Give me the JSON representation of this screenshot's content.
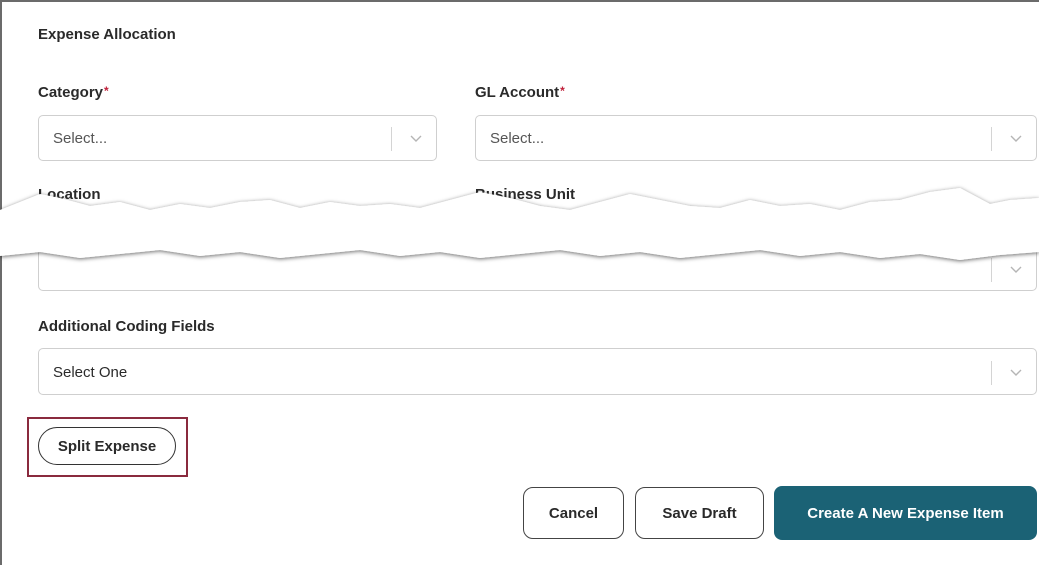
{
  "section": {
    "title": "Expense Allocation"
  },
  "fields": {
    "category": {
      "label": "Category",
      "required_mark": "*",
      "value": "Select..."
    },
    "gl_account": {
      "label": "GL Account",
      "required_mark": "*",
      "value": "Select..."
    },
    "location": {
      "label": "Location"
    },
    "business_unit": {
      "label": "Business Unit"
    },
    "additional": {
      "label": "Additional Coding Fields",
      "value": "Select One"
    }
  },
  "buttons": {
    "split": "Split Expense",
    "cancel": "Cancel",
    "save_draft": "Save Draft",
    "create": "Create A New Expense Item"
  },
  "colors": {
    "primary": "#1b6275",
    "required": "#c0203a",
    "highlight": "#8a2a3e"
  },
  "icons": {
    "dropdown": "chevron-down-icon"
  }
}
